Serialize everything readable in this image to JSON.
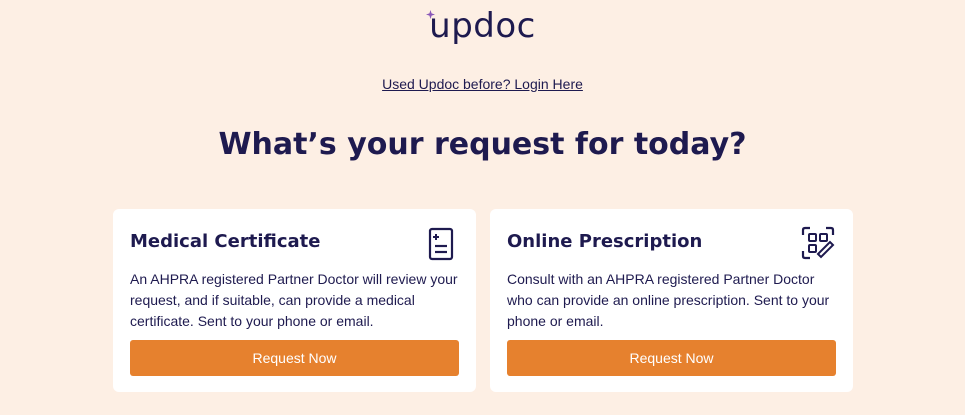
{
  "brand": {
    "logo_text": "updoc",
    "primary_color": "#1e1a4f",
    "accent_color": "#8a58b8",
    "background": "#fdefe4"
  },
  "login": {
    "link_text": "Used Updoc before? Login Here"
  },
  "headline": "What’s your request for today?",
  "cards": [
    {
      "title": "Medical Certificate",
      "icon": "medical-certificate-icon",
      "description": "An AHPRA registered Partner Doctor will review your request, and if suitable, can provide a medical certificate. Sent to your phone or email.",
      "button_label": "Request Now"
    },
    {
      "title": "Online Prescription",
      "icon": "prescription-qr-icon",
      "description": "Consult with an AHPRA registered Partner Doctor who can provide an online prescription. Sent to your phone or email.",
      "button_label": "Request Now"
    }
  ],
  "button_color": "#e6812e"
}
